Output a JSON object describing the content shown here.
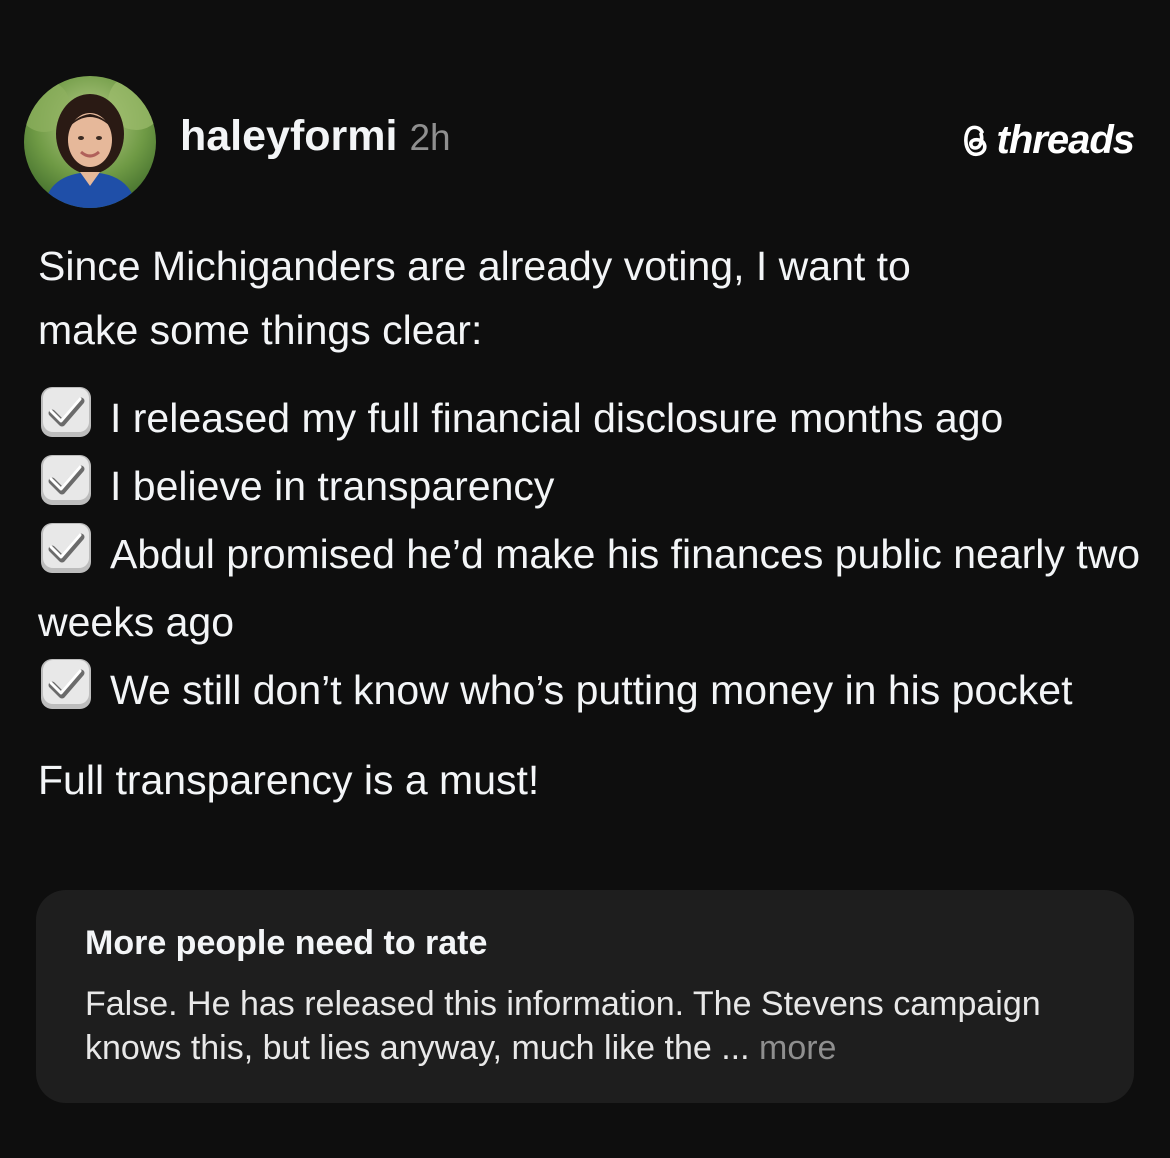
{
  "post": {
    "author": {
      "username": "haleyformi",
      "time_ago": "2h",
      "avatar_icon": "profile-photo"
    },
    "brand": {
      "name": "threads",
      "icon": "threads-logo-icon"
    },
    "intro_line_1": "Since Michiganders are already voting, I want to",
    "intro_line_2": "make some things clear:",
    "checklist": [
      {
        "icon": "check-mark-button-emoji",
        "text": "I released my full financial disclosure months ago"
      },
      {
        "icon": "check-mark-button-emoji",
        "text": "I believe in transparency"
      },
      {
        "icon": "check-mark-button-emoji",
        "text": "Abdul promised he’d make his finances public nearly two weeks ago"
      },
      {
        "icon": "check-mark-button-emoji",
        "text": "We still don’t know who’s putting money in his pocket"
      }
    ],
    "closing": "Full transparency is a must!"
  },
  "community_note": {
    "title": "More people need to rate",
    "text": "False. He has released this information. The Stevens campaign knows this, but lies anyway, much like the ...",
    "more_label": "more"
  },
  "colors": {
    "background": "#0e0e0e",
    "text": "#f3f5f7",
    "muted": "#8f8f8f",
    "note_background": "#1e1e1e"
  }
}
